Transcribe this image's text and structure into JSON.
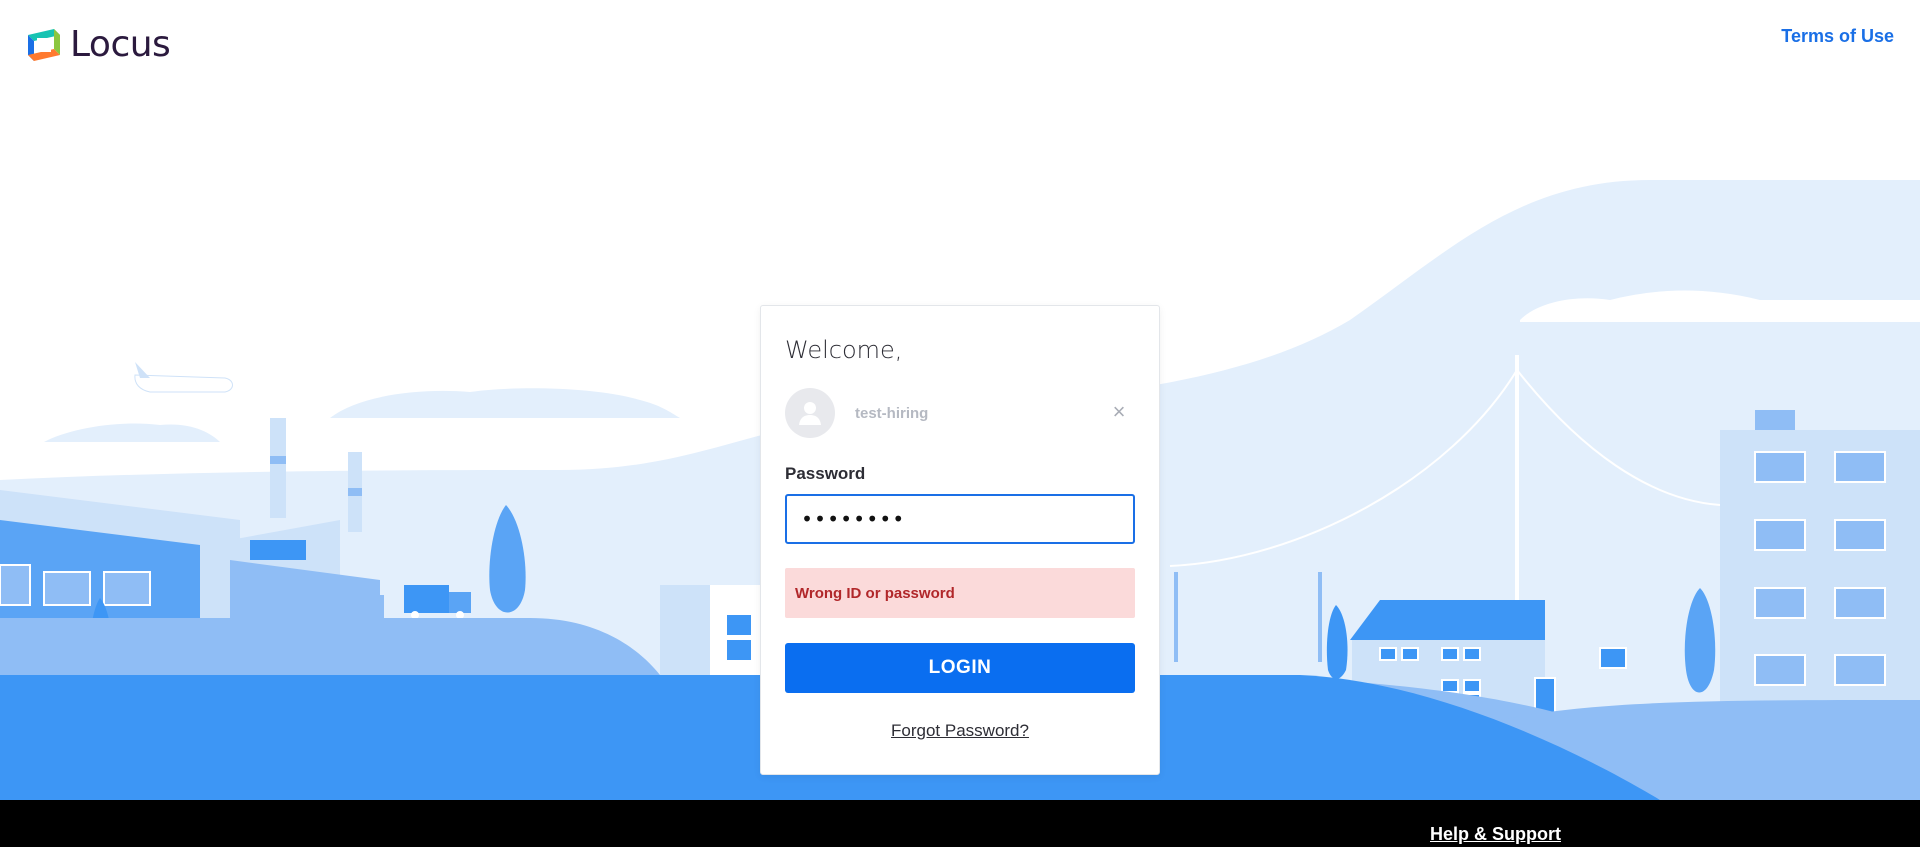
{
  "header": {
    "brand": "Locus",
    "terms_link": "Terms of Use"
  },
  "login": {
    "welcome": "Welcome,",
    "username": "test-hiring",
    "clear_icon": "×",
    "password_label": "Password",
    "password_value": "••••••••",
    "error_message": "Wrong ID or password",
    "login_button": "LOGIN",
    "forgot_link": "Forgot Password?"
  },
  "footer": {
    "help_link": "Help & Support"
  },
  "colors": {
    "accent": "#0a6ef0",
    "error_bg": "#fbdada",
    "error_text": "#b1272a",
    "ground": "#3d96f5",
    "sky_light": "#e3effc"
  }
}
